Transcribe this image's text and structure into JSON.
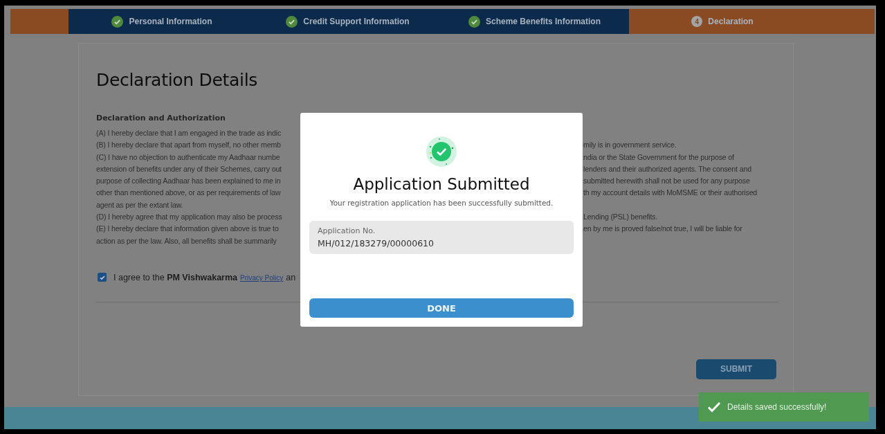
{
  "steps": [
    {
      "label": "Personal Information",
      "selected": false,
      "kind": "done"
    },
    {
      "label": "Credit Support Information",
      "selected": false,
      "kind": "done"
    },
    {
      "label": "Scheme Benefits Information",
      "selected": false,
      "kind": "done"
    },
    {
      "label": "Declaration",
      "selected": true,
      "kind": "numbered",
      "number": "4"
    }
  ],
  "page": {
    "title": "Declaration Details",
    "section_heading": "Declaration and Authorization",
    "declaration_lines": [
      {
        "left": "(A) I hereby declare that I am engaged in the trade as indic"
      },
      {
        "left": "(B) I hereby declare that apart from myself, no other memb",
        "right": "mily is in government service."
      },
      {
        "left": "(C) I have no objection to authenticate my Aadhaar numbe",
        "right": "ndia or the State Government for the purpose of"
      },
      {
        "left": "extension of benefits under any of their Schemes, carry out",
        "right": "lenders and their authorized agents. The consent and"
      },
      {
        "left": "purpose of collecting Aadhaar has been explained to me in",
        "right": "submitted herewith shall not be used for any purpose"
      },
      {
        "left": "other than mentioned above, or as per requirements of law",
        "right": "th my account details with MoMSME or their authorised"
      },
      {
        "left": "agent as per the extant law."
      },
      {
        "left": "(D) I hereby agree that my application may also be process",
        "right": "Lending (PSL) benefits."
      },
      {
        "left": "(E) I hereby declare that information given above is true to",
        "right": "en by me is proved false/not true, I will be liable for"
      },
      {
        "left": "action as per the law. Also, all benefits shall be summarily"
      }
    ],
    "agreement": {
      "checked": true,
      "text": "I agree to the **PM Vishwakarma**",
      "link": "Privacy Policy",
      "tail": "an"
    },
    "submit_button": "SUBMIT"
  },
  "dialog": {
    "title": "Application Submitted",
    "message": "Your registration application has been successfully submitted.",
    "field_label": "Application No.",
    "field_value": "MH/012/183279/00000610",
    "done_button": "DONE"
  },
  "toast": {
    "message": "Details saved successfully!"
  }
}
